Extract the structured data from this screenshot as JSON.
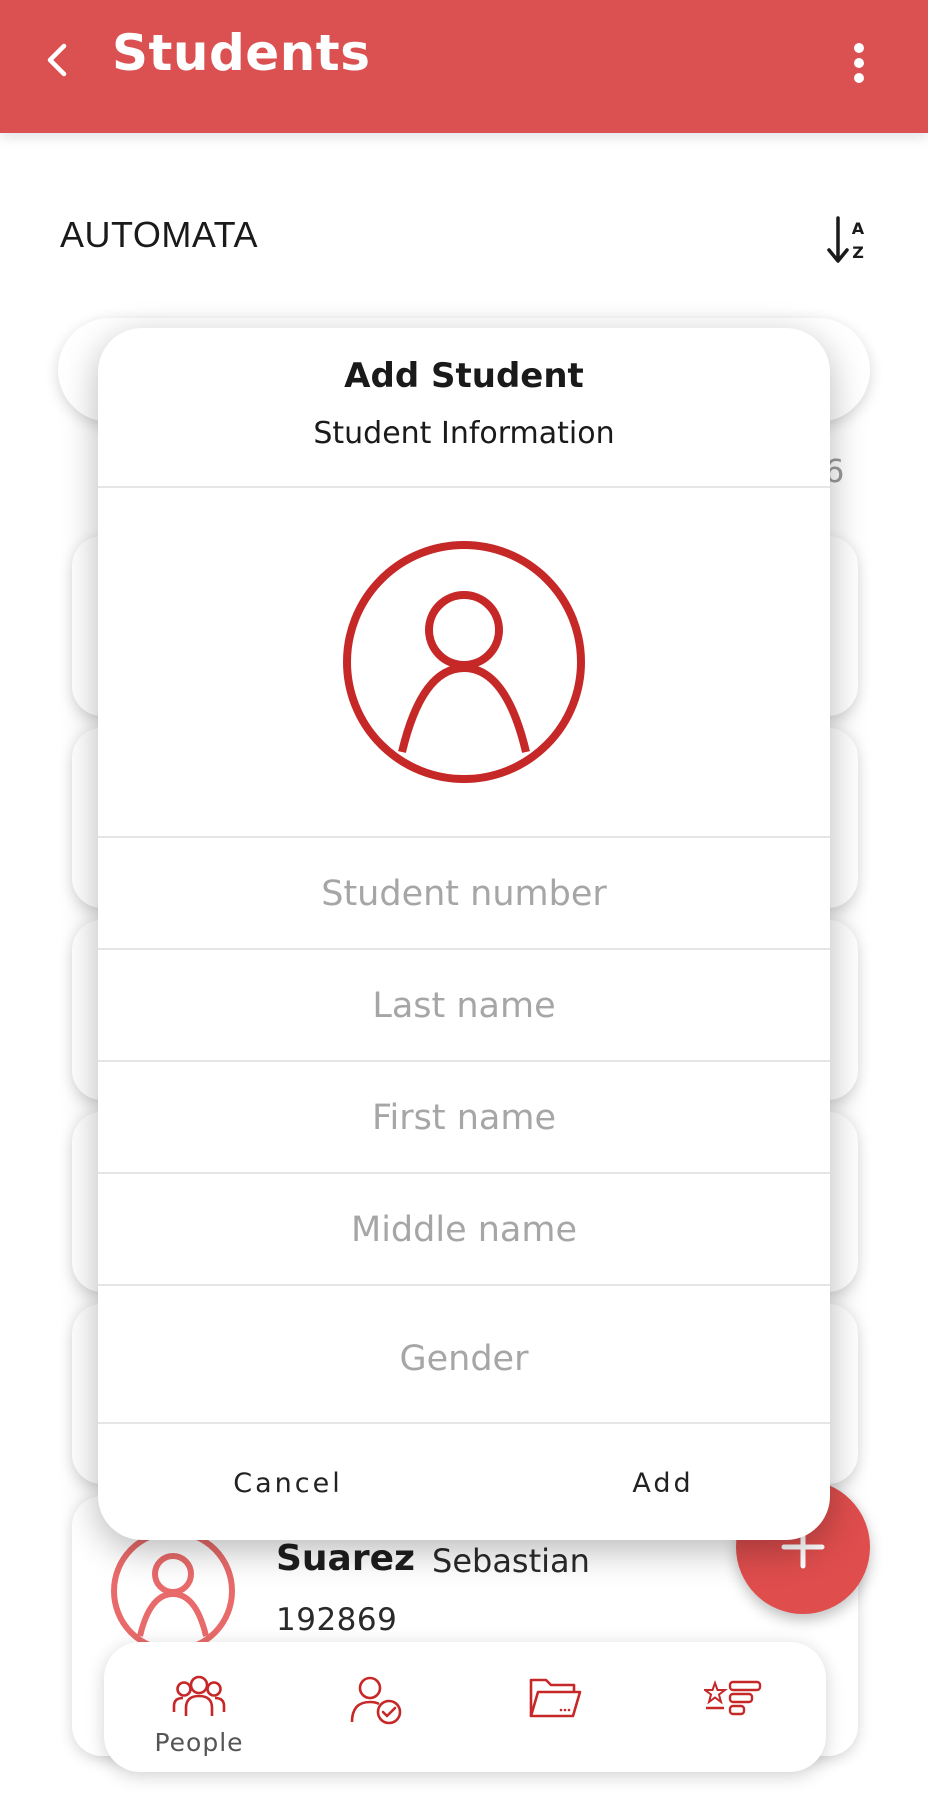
{
  "app_bar": {
    "title": "Students",
    "back_icon": "chevron-left-icon",
    "menu_icon": "more-vertical-icon",
    "color": "#db5050"
  },
  "section": {
    "class_name": "AUTOMATA",
    "sort_icon": "sort-az-icon"
  },
  "list": {
    "count_peek": "6",
    "visible_student": {
      "last_name": "Suarez",
      "first_name": "Sebastian",
      "student_number": "192869"
    }
  },
  "fab": {
    "icon": "plus-icon",
    "color": "#df4d4d"
  },
  "dialog": {
    "title": "Add Student",
    "subtitle": "Student Information",
    "avatar_icon": "user-circle-icon",
    "accent_color": "#c62828",
    "fields": {
      "student_number": {
        "placeholder": "Student number",
        "value": ""
      },
      "last_name": {
        "placeholder": "Last name",
        "value": ""
      },
      "first_name": {
        "placeholder": "First name",
        "value": ""
      },
      "middle_name": {
        "placeholder": "Middle name",
        "value": ""
      },
      "gender": {
        "placeholder": "Gender",
        "value": ""
      }
    },
    "cancel_label": "Cancel",
    "add_label": "Add"
  },
  "bottom_nav": {
    "items": [
      {
        "label": "People",
        "icon": "people-icon",
        "active": true
      },
      {
        "label": "",
        "icon": "attendance-check-icon"
      },
      {
        "label": "",
        "icon": "folder-icon"
      },
      {
        "label": "",
        "icon": "grades-star-icon"
      }
    ]
  }
}
